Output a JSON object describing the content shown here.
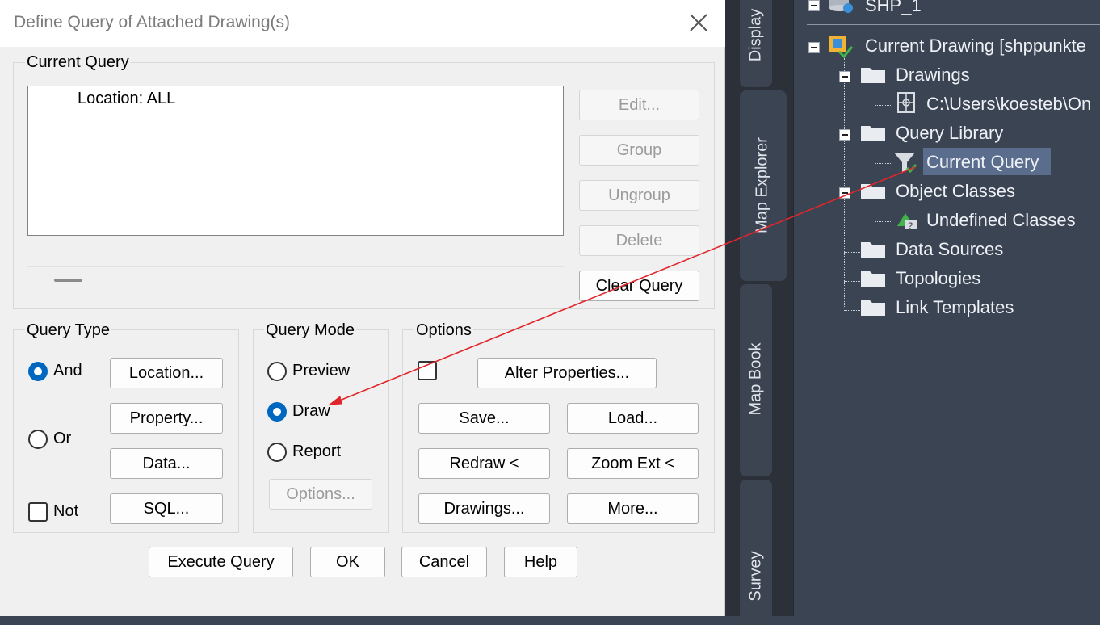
{
  "dialog": {
    "title": "Define Query of Attached Drawing(s)",
    "current_query": {
      "group_label": "Current Query",
      "lines": [
        "Location: ALL"
      ],
      "buttons": {
        "edit": "Edit...",
        "group": "Group",
        "ungroup": "Ungroup",
        "delete": "Delete",
        "clear_query": "Clear Query"
      }
    },
    "query_type": {
      "group_label": "Query Type",
      "and_label": "And",
      "or_label": "Or",
      "not_label": "Not",
      "selected": "And",
      "buttons": {
        "location": "Location...",
        "property": "Property...",
        "data": "Data...",
        "sql": "SQL..."
      }
    },
    "query_mode": {
      "group_label": "Query Mode",
      "preview_label": "Preview",
      "draw_label": "Draw",
      "report_label": "Report",
      "selected": "Draw",
      "options_button": "Options..."
    },
    "options": {
      "group_label": "Options",
      "buttons": {
        "alter_properties": "Alter Properties...",
        "save": "Save...",
        "load": "Load...",
        "redraw": "Redraw <",
        "zoom_ext": "Zoom Ext <",
        "drawings": "Drawings...",
        "more": "More..."
      }
    },
    "bottom_buttons": {
      "execute_query": "Execute Query",
      "ok": "OK",
      "cancel": "Cancel",
      "help": "Help"
    }
  },
  "side_tabs": [
    "Display",
    "Map Explorer",
    "Map Book",
    "Survey"
  ],
  "tree": {
    "shp_node": "SHP_1",
    "current_drawing": "Current Drawing [shppunkte",
    "drawings": "Drawings",
    "drawing_path": "C:\\Users\\koesteb\\On",
    "query_library": "Query Library",
    "current_query": "Current Query",
    "object_classes": "Object Classes",
    "undefined_classes": "Undefined Classes",
    "data_sources": "Data Sources",
    "topologies": "Topologies",
    "link_templates": "Link Templates"
  },
  "colors": {
    "accent": "#0067c0",
    "arrow": "#e0262b",
    "tree_bg": "#3b4453",
    "selection": "#5b6d8d"
  }
}
